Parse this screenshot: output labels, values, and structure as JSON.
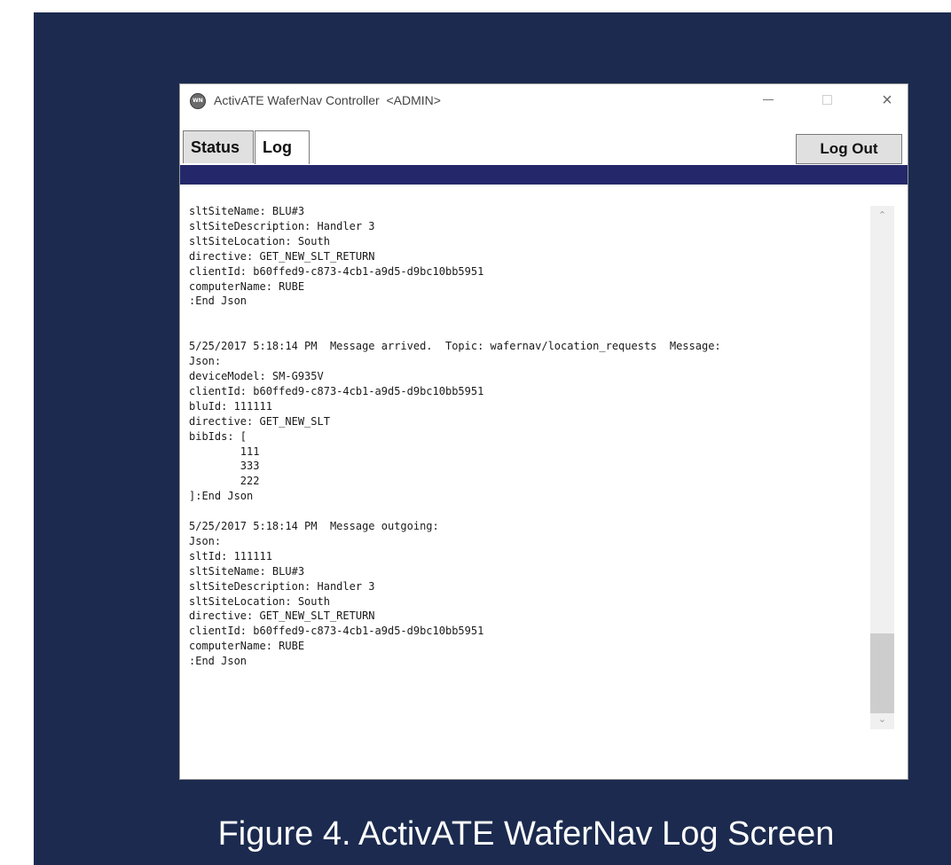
{
  "window": {
    "title": "ActivATE WaferNav Controller  <ADMIN>",
    "icon_text": "WN",
    "controls": {
      "minimize": "minimize-icon",
      "maximize": "maximize-icon",
      "close": "×"
    }
  },
  "tabs": [
    {
      "label": "Status",
      "active": false
    },
    {
      "label": "Log",
      "active": true
    }
  ],
  "logout_button": "Log Out",
  "log": {
    "text": "sltSiteName: BLU#3\nsltSiteDescription: Handler 3\nsltSiteLocation: South\ndirective: GET_NEW_SLT_RETURN\nclientId: b60ffed9-c873-4cb1-a9d5-d9bc10bb5951\ncomputerName: RUBE\n:End Json\n\n\n5/25/2017 5:18:14 PM  Message arrived.  Topic: wafernav/location_requests  Message:\nJson:\ndeviceModel: SM-G935V\nclientId: b60ffed9-c873-4cb1-a9d5-d9bc10bb5951\nbluId: 111111\ndirective: GET_NEW_SLT\nbibIds: [\n        111\n        333\n        222\n]:End Json\n\n5/25/2017 5:18:14 PM  Message outgoing:\nJson:\nsltId: 111111\nsltSiteName: BLU#3\nsltSiteDescription: Handler 3\nsltSiteLocation: South\ndirective: GET_NEW_SLT_RETURN\nclientId: b60ffed9-c873-4cb1-a9d5-d9bc10bb5951\ncomputerName: RUBE\n:End Json"
  },
  "scrollbar": {
    "up": "^",
    "down": "v",
    "position": 0.88
  },
  "caption": "Figure 4. ActivATE WaferNav Log Screen",
  "colors": {
    "panel_background": "#1b2a4e",
    "header_bar": "#24286a",
    "caption_text": "#ffffff"
  }
}
